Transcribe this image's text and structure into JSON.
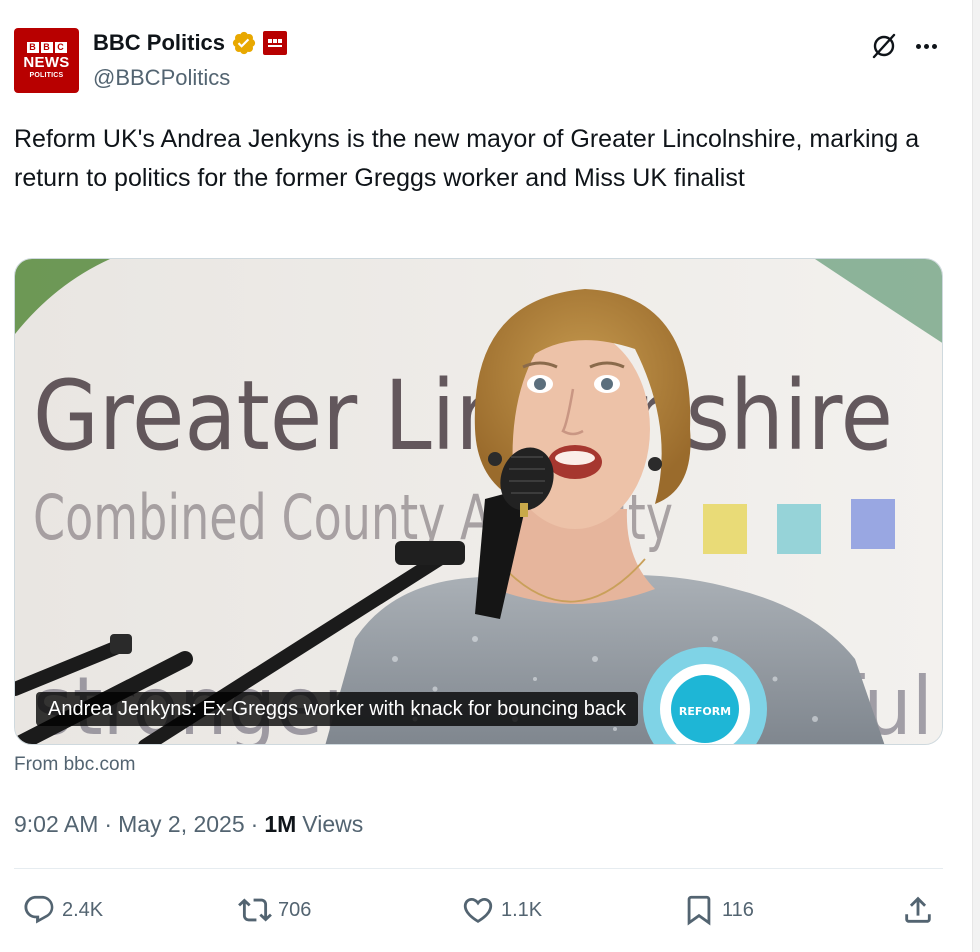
{
  "account": {
    "avatar_text": {
      "line1": [
        "B",
        "B",
        "C"
      ],
      "line2": "NEWS",
      "line3": "POLITICS"
    },
    "display_name": "BBC Politics",
    "handle": "@BBCPolitics",
    "verified_icon": "gold-verified-badge-icon",
    "affiliate_icon": "bbc-news-affiliate-icon"
  },
  "header_actions": {
    "grok_icon": "grok-icon",
    "more_icon": "more-options-icon"
  },
  "tweet": {
    "text": "Reform UK's Andrea Jenkyns is the new mayor of Greater Lincolnshire, marking a return to politics for the former Greggs worker and Miss UK finalist"
  },
  "link_card": {
    "image_sign_line1": "Greater Lincolnshire",
    "image_sign_line2": "Combined County Authority",
    "image_sign_line3": "stronger more powerful",
    "rosette_text": "REFORM",
    "caption": "Andrea Jenkyns: Ex-Greggs worker with knack for bouncing back",
    "source": "From bbc.com"
  },
  "meta": {
    "time": "9:02 AM",
    "date": "May 2, 2025",
    "separator": "·",
    "views_count": "1M",
    "views_label": "Views"
  },
  "actions": {
    "replies": "2.4K",
    "reposts": "706",
    "likes": "1.1K",
    "bookmarks": "116"
  },
  "colors": {
    "text_primary": "#0f1419",
    "text_secondary": "#536471",
    "bbc_red": "#b80000",
    "verified_gold": "#e8a800"
  }
}
